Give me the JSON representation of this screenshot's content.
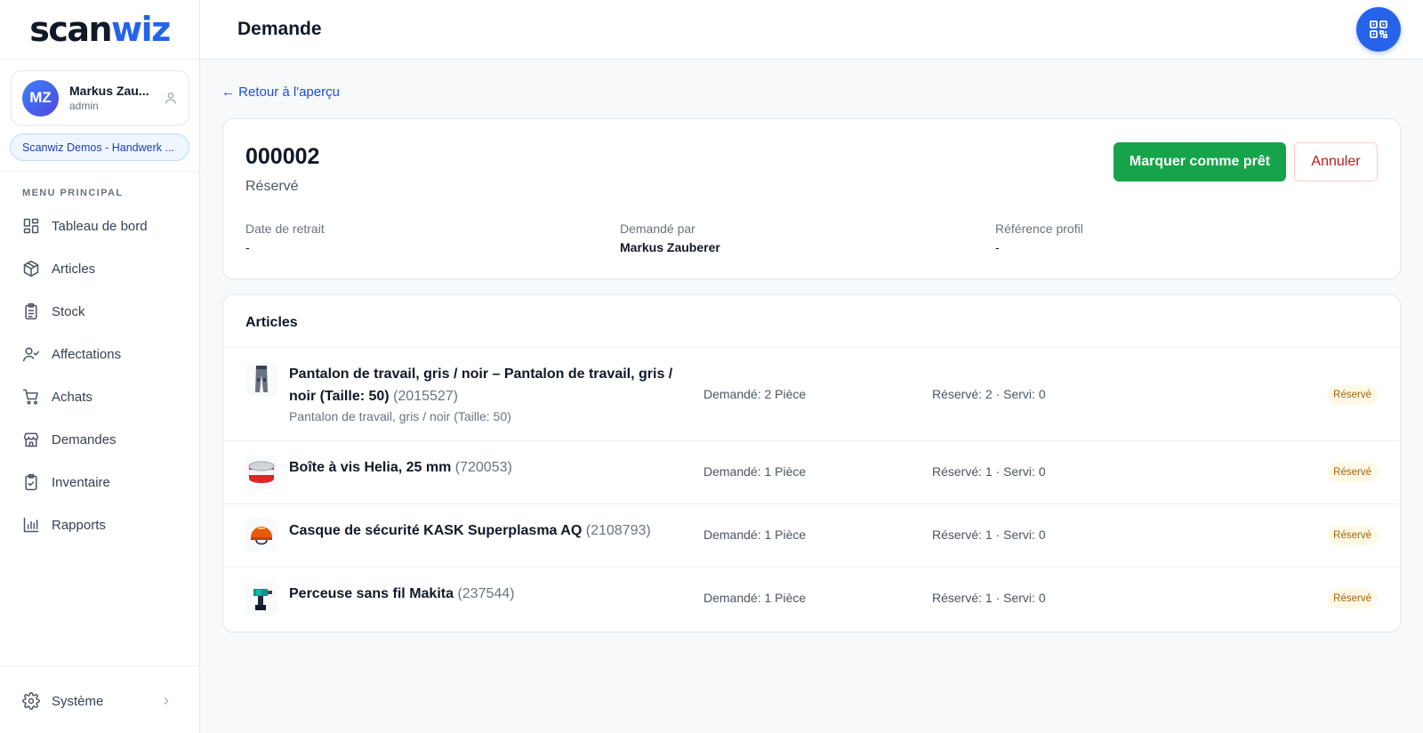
{
  "logo": {
    "part1": "scan",
    "part2": "wiz"
  },
  "user": {
    "initials": "MZ",
    "name": "Markus Zau...",
    "role": "admin"
  },
  "tenant": "Scanwiz Demos - Handwerk ...",
  "menu": {
    "title": "MENU PRINCIPAL",
    "items": [
      {
        "label": "Tableau de bord",
        "icon": "dashboard-icon"
      },
      {
        "label": "Articles",
        "icon": "package-icon"
      },
      {
        "label": "Stock",
        "icon": "clipboard-list-icon"
      },
      {
        "label": "Affectations",
        "icon": "user-check-icon"
      },
      {
        "label": "Achats",
        "icon": "cart-icon"
      },
      {
        "label": "Demandes",
        "icon": "store-icon"
      },
      {
        "label": "Inventaire",
        "icon": "clipboard-check-icon"
      },
      {
        "label": "Rapports",
        "icon": "bar-chart-icon"
      }
    ]
  },
  "system": {
    "label": "Système"
  },
  "header": {
    "title": "Demande"
  },
  "back_link": "← Retour à l'aperçu",
  "request": {
    "number": "000002",
    "status": "Réservé",
    "actions": {
      "ready": "Marquer comme prêt",
      "cancel": "Annuler"
    },
    "fields": [
      {
        "label": "Date de retrait",
        "value": "-"
      },
      {
        "label": "Demandé par",
        "value": "Markus Zauberer"
      },
      {
        "label": "Référence profil",
        "value": "-"
      }
    ]
  },
  "articles": {
    "title": "Articles",
    "rows": [
      {
        "name": "Pantalon de travail, gris / noir – Pantalon de travail, gris / noir (Taille: 50)",
        "code": "(2015527)",
        "subtitle": "Pantalon de travail, gris / noir (Taille: 50)",
        "requested": "Demandé: 2 Pièce",
        "served": "Réservé: 2 · Servi: 0",
        "status": "Réservé",
        "thumb": "pants-image"
      },
      {
        "name": "Boîte à vis Helia, 25 mm",
        "code": "(720053)",
        "subtitle": "",
        "requested": "Demandé: 1 Pièce",
        "served": "Réservé: 1 · Servi: 0",
        "status": "Réservé",
        "thumb": "screw-box-image"
      },
      {
        "name": "Casque de sécurité KASK Superplasma AQ",
        "code": "(2108793)",
        "subtitle": "",
        "requested": "Demandé: 1 Pièce",
        "served": "Réservé: 1 · Servi: 0",
        "status": "Réservé",
        "thumb": "helmet-image"
      },
      {
        "name": "Perceuse sans fil Makita",
        "code": "(237544)",
        "subtitle": "",
        "requested": "Demandé: 1 Pièce",
        "served": "Réservé: 1 · Servi: 0",
        "status": "Réservé",
        "thumb": "drill-image"
      }
    ]
  },
  "colors": {
    "primary": "#2563eb",
    "success": "#16a34a",
    "danger": "#b91c1c",
    "badge_bg": "#fef9e7",
    "badge_text": "#a16207"
  }
}
